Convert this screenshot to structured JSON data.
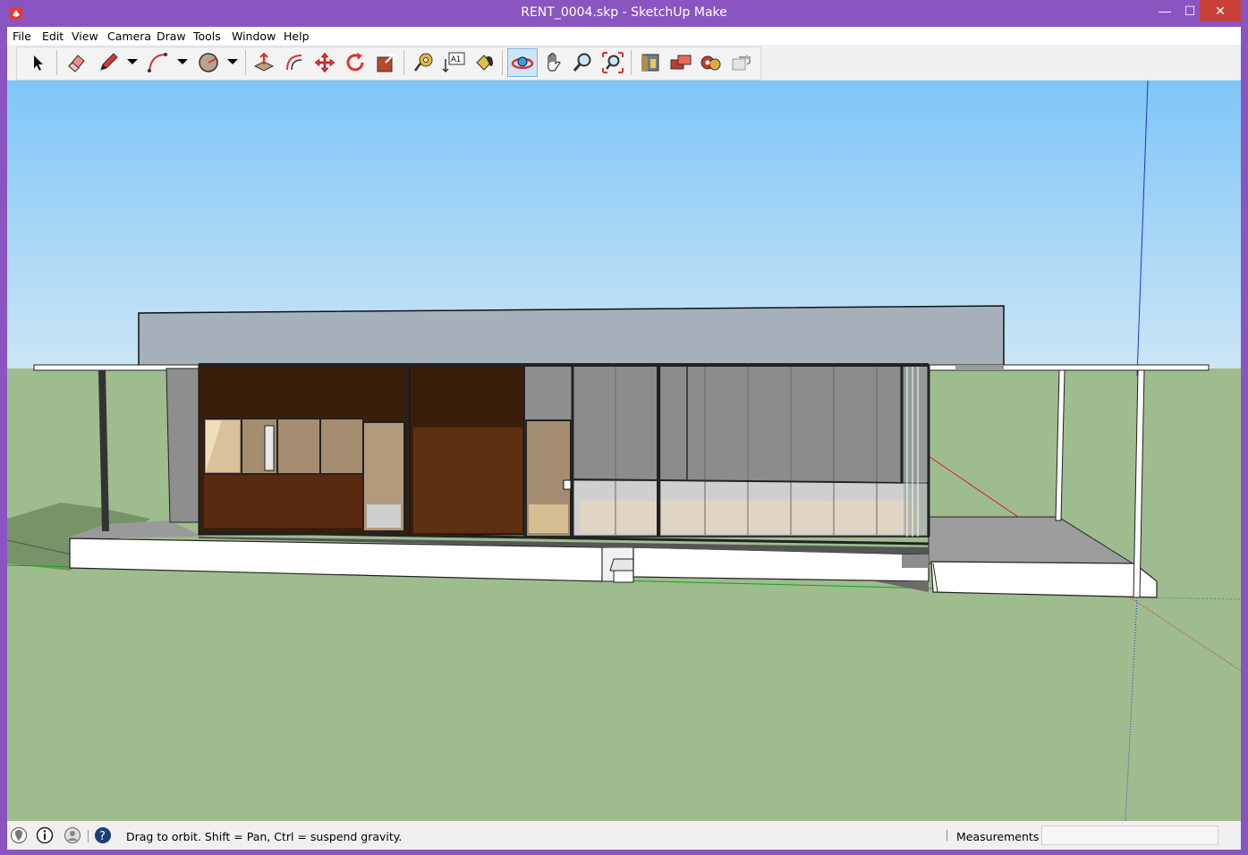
{
  "window": {
    "title": "RENT_0004.skp - SketchUp Make",
    "controls": {
      "minimize": "—",
      "maximize": "☐",
      "close": "✕"
    }
  },
  "menu": [
    {
      "label": "File"
    },
    {
      "label": "Edit"
    },
    {
      "label": "View"
    },
    {
      "label": "Camera"
    },
    {
      "label": "Draw"
    },
    {
      "label": "Tools"
    },
    {
      "label": "Window"
    },
    {
      "label": "Help"
    }
  ],
  "toolbar": {
    "tools": [
      "select-icon",
      "eraser-icon",
      "pencil-icon",
      "arc-icon",
      "circle-icon",
      "push-pull-icon",
      "offset-icon",
      "move-icon",
      "rotate-icon",
      "scale-icon",
      "tape-measure-icon",
      "text-icon",
      "paint-bucket-icon",
      "orbit-icon",
      "pan-icon",
      "zoom-icon",
      "zoom-extents-icon",
      "3d-warehouse-icon",
      "component-share-icon",
      "extension-warehouse-icon",
      "layout-send-icon"
    ],
    "active_tool": "orbit-icon",
    "text_tool_glyph": "A1"
  },
  "status": {
    "hint": "Drag to orbit. Shift = Pan, Ctrl = suspend gravity.",
    "measurements_label": "Measurements",
    "measurements_value": ""
  },
  "colors": {
    "titlebar": "#8a55c0",
    "sky_top": "#7ec6f8",
    "sky_bottom": "#cde6f5",
    "ground": "#9ebc8e",
    "active_tool_bg": "#cde6f7"
  }
}
